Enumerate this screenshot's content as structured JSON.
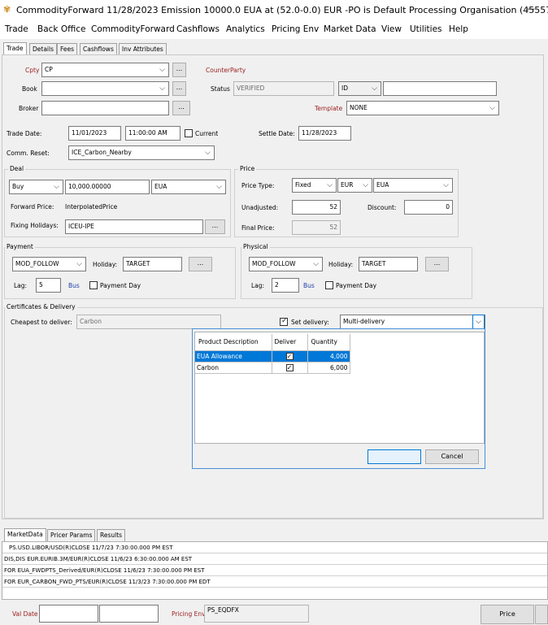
{
  "window": {
    "title": "CommodityForward 11/28/2023 Emission 10000.0 EUA at (52.0-0.0) EUR  -PO is Default Processing Organisation  (45557...",
    "minimize": "—"
  },
  "menu": [
    "Trade",
    "Back Office",
    "CommodityForward",
    "Cashflows",
    "Analytics",
    "Pricing Env",
    "Market Data",
    "View",
    "Utilities",
    "Help"
  ],
  "tabs": [
    "Trade",
    "Details",
    "Fees",
    "Cashflows",
    "Inv Attributes"
  ],
  "form": {
    "cpty_label": "Cpty",
    "cpty_value": "CP",
    "counterparty_label": "CounterParty",
    "book_label": "Book",
    "book_value": "",
    "status_label": "Status",
    "status_value": "VERIFIED",
    "id_label": "ID",
    "id_value": "",
    "broker_label": "Broker",
    "broker_value": "",
    "template_label": "Template",
    "template_value": "NONE",
    "trade_date_label": "Trade Date:",
    "trade_date": "11/01/2023",
    "trade_time": "11:00:00 AM",
    "current_label": "Current",
    "settle_date_label": "Settle Date:",
    "settle_date": "11/28/2023",
    "comm_reset_label": "Comm. Reset:",
    "comm_reset": "ICE_Carbon_Nearby",
    "ellipsis": "..."
  },
  "deal": {
    "legend": "Deal",
    "direction": "Buy",
    "quantity": "10,000.00000",
    "unit": "EUA",
    "unit2": "EUA",
    "fwd_price_label": "Forward Price:",
    "fwd_price": "InterpolatedPrice",
    "fixing_label": "Fixing Holidays:",
    "fixing": "ICEU-IPE"
  },
  "price": {
    "legend": "Price",
    "type_label": "Price Type:",
    "type": "Fixed",
    "currency": "EUR",
    "unit": "EUA",
    "unadjusted_label": "Unadjusted:",
    "unadjusted": "52",
    "discount_label": "Discount:",
    "discount": "0",
    "final_label": "Final Price:",
    "final": "52"
  },
  "payment": {
    "legend": "Payment",
    "rule": "MOD_FOLLOW",
    "holiday_label": "Holiday:",
    "holiday": "TARGET",
    "lag_label": "Lag:",
    "lag": "5",
    "bus": "Bus",
    "payday_label": "Payment Day"
  },
  "physical": {
    "legend": "Physical",
    "rule": "MOD_FOLLOW",
    "holiday_label": "Holiday:",
    "holiday": "TARGET",
    "lag_label": "Lag:",
    "lag": "2",
    "bus": "Bus",
    "payday_label": "Payment Day"
  },
  "certs": {
    "legend": "Certificates & Delivery",
    "cheapest_label": "Cheapest to deliver:",
    "cheapest": "Carbon",
    "set_delivery_label": "Set delivery:",
    "set_delivery": "Multi-delivery"
  },
  "delivery_table": {
    "headers": [
      "Product Description",
      "Deliver",
      "Quantity"
    ],
    "rows": [
      {
        "desc": "EUA Allowance",
        "deliver": true,
        "qty": "4,000"
      },
      {
        "desc": "Carbon",
        "deliver": true,
        "qty": "6,000"
      }
    ],
    "cancel": "Cancel"
  },
  "bottom_tabs": [
    "MarketData",
    "Pricer Params",
    "Results"
  ],
  "market_data": [
    "PS.USD.LIBOR/USD(R)CLOSE 11/7/23 7:30:00.000 PM EST",
    "DIS,DIS  EUR.EURIB.3M/EUR(R)CLOSE 11/6/23 6:30:00.000 AM EST",
    "FOR  EUA_FWDPTS_Derived/EUR(R)CLOSE 11/6/23 7:30:00.000 PM EST",
    "FOR  EUR_CARBON_FWD_PTS/EUR(R)CLOSE 11/3/23 7:30:00.000 PM EDT"
  ],
  "status": {
    "val_date_label": "Val Date",
    "pricing_env_label": "Pricing Env",
    "pricing_env": "PS_EQDFX",
    "price_button": "Price"
  }
}
